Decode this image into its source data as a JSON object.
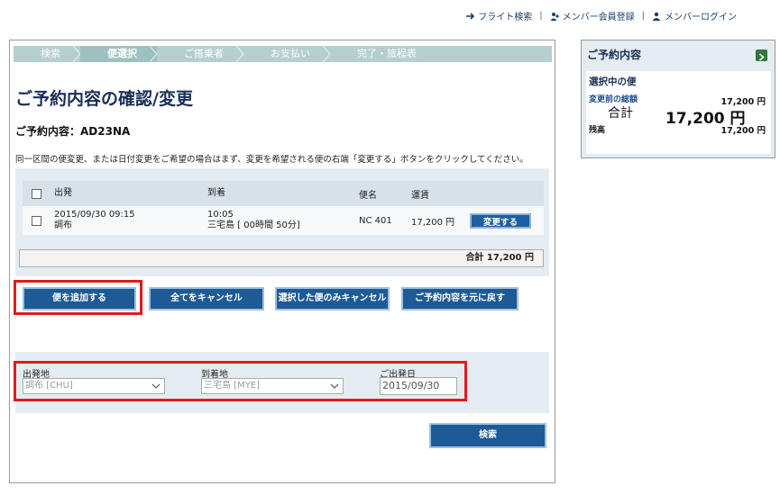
{
  "header_links": [
    {
      "label": "フライト検索",
      "icon": "airplane-icon"
    },
    {
      "label": "メンバー会員登録",
      "icon": "member-register-icon"
    },
    {
      "label": "メンバーログイン",
      "icon": "member-login-icon"
    }
  ],
  "separator": "|",
  "steps": [
    "検索",
    "便選択",
    "ご搭乗者",
    "お支払い",
    "完了・旅程表"
  ],
  "active_step": "便選択",
  "page_title": "ご予約内容の確認/変更",
  "reservation": "ご予約内容：AD23NA",
  "note": "同一区間の便変更、または日付変更をご希望の場合はまず、変更を希望される便の右端「変更する」ボタンをクリックしてください。",
  "table": {
    "headers": {
      "dep": "出発",
      "arr": "到着",
      "no": "便名",
      "fare": "運賃"
    },
    "rows": [
      {
        "dep_line1": "2015/09/30 09:15",
        "dep_line2": "調布",
        "arr_line1": "10:05",
        "arr_line2": "三宅島 [ 00時間 50分]",
        "flight_no": "NC 401",
        "fare": "17,200 円",
        "action": "変更する"
      }
    ],
    "total": "合計 17,200 円"
  },
  "actions": {
    "add_flight": "便を追加する",
    "cancel_all": "全てをキャンセル",
    "cancel_selected": "選択した便のみキャンセル",
    "restore": "ご予約内容を元に戻す"
  },
  "search": {
    "origin_label": "出発地",
    "origin_value": "調布 [CHU]",
    "dest_label": "到着地",
    "dest_value": "三宅島 [MYE]",
    "date_label": "ご出発日",
    "date_value": "2015/09/30",
    "submit": "検索"
  },
  "sidebar": {
    "title": "ご予約内容",
    "selected_label": "選択中の便",
    "prev_total_label": "変更前の総額",
    "prev_total_value": "17,200 円",
    "sum_label": "合計",
    "sum_value": "17,200 円",
    "balance_label": "残高",
    "balance_value": "17,200 円"
  },
  "colors": {
    "accent": "#1d5a96",
    "highlight": "#e11b1b",
    "panel": "#e4ecf2"
  }
}
